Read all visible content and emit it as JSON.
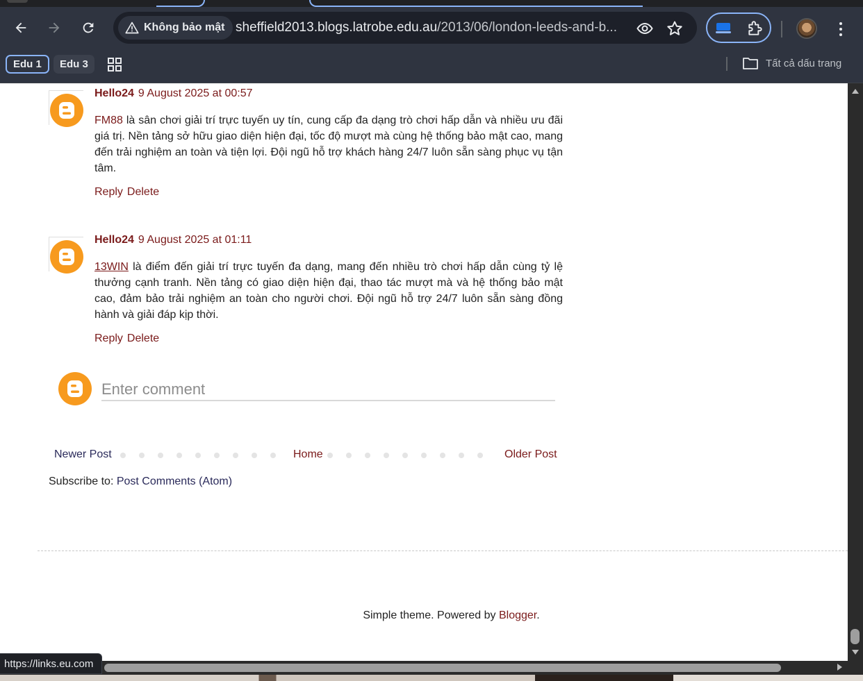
{
  "browser": {
    "security_label": "Không bảo mật",
    "url_host": "sheffield2013.blogs.latrobe.edu.au",
    "url_path": "/2013/06/london-leeds-and-b...",
    "bookmarks": [
      {
        "label": "Edu 1",
        "active": true
      },
      {
        "label": "Edu 3",
        "active": false
      }
    ],
    "all_bookmarks_label": "Tất cả dấu trang",
    "status_url": "https://links.eu.com"
  },
  "comments": [
    {
      "author": "Hello24",
      "time": "9 August 2025 at 00:57",
      "link_text": "FM88",
      "link_underlined": false,
      "body": " là sân chơi giải trí trực tuyến uy tín, cung cấp đa dạng trò chơi hấp dẫn và nhiều ưu đãi giá trị. Nền tảng sở hữu giao diện hiện đại, tốc độ mượt mà cùng hệ thống bảo mật cao, mang đến trải nghiệm an toàn và tiện lợi. Đội ngũ hỗ trợ khách hàng 24/7 luôn sẵn sàng phục vụ tận tâm.",
      "reply_label": "Reply",
      "delete_label": "Delete"
    },
    {
      "author": "Hello24",
      "time": "9 August 2025 at 01:11",
      "link_text": "13WIN",
      "link_underlined": true,
      "body": " là điểm đến giải trí trực tuyến đa dạng, mang đến nhiều trò chơi hấp dẫn cùng tỷ lệ thưởng cạnh tranh. Nền tảng có giao diện hiện đại, thao tác mượt mà và hệ thống bảo mật cao, đảm bảo trải nghiệm an toàn cho người chơi. Đội ngũ hỗ trợ 24/7 luôn sẵn sàng đồng hành và giải đáp kịp thời.",
      "reply_label": "Reply",
      "delete_label": "Delete"
    }
  ],
  "comment_form": {
    "placeholder": "Enter comment"
  },
  "pager": {
    "newer": "Newer Post",
    "home": "Home",
    "older": "Older Post"
  },
  "subscribe": {
    "label": "Subscribe to: ",
    "link": "Post Comments (Atom)"
  },
  "footer": {
    "text": "Simple theme. Powered by ",
    "link": "Blogger",
    "suffix": "."
  },
  "colors": {
    "link_maroon": "#7a1a1a",
    "blogger_orange": "#f79a1e",
    "chrome_bg": "#2f3440",
    "accent_blue": "#8ab4f8"
  }
}
